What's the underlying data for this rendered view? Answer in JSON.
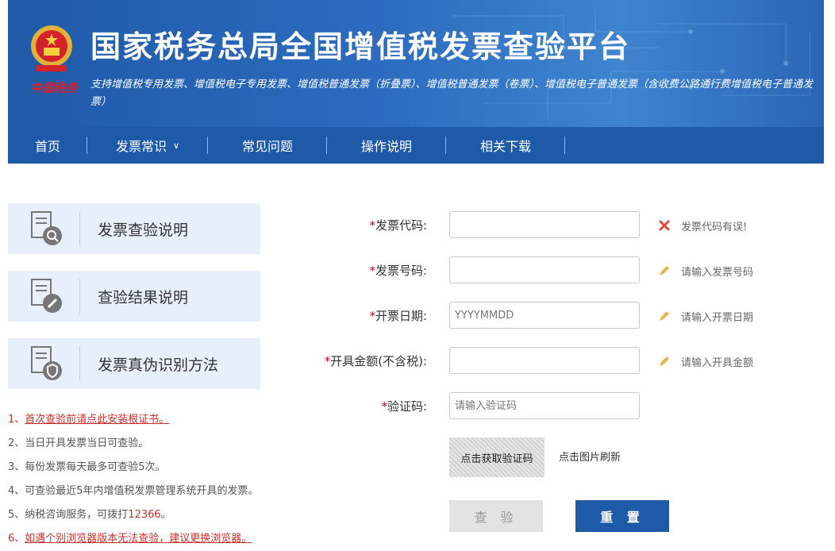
{
  "header": {
    "title": "国家税务总局全国增值税发票查验平台",
    "emblem_text": "中国税务",
    "subtitle": "支持增值税专用发票、增值税电子专用发票、增值税普通发票（折叠票）、增值税普通发票（卷票）、增值税电子普通发票（含收费公路通行费增值税电子普通发票）"
  },
  "nav": [
    {
      "label": "首页"
    },
    {
      "label": "发票常识",
      "icon": "chevron-down-icon"
    },
    {
      "label": "常见问题"
    },
    {
      "label": "操作说明"
    },
    {
      "label": "相关下载"
    }
  ],
  "sidebar": [
    {
      "label": "发票查验说明",
      "icon": "document-search-icon"
    },
    {
      "label": "查验结果说明",
      "icon": "document-edit-icon"
    },
    {
      "label": "发票真伪识别方法",
      "icon": "document-shield-icon"
    }
  ],
  "notes": [
    {
      "prefix": "1、",
      "text": "首次查验前请点此安装根证书。"
    },
    {
      "prefix": "2、",
      "text": "当日开具发票当日可查验。"
    },
    {
      "prefix": "3、",
      "text": "每份发票每天最多可查验5次。"
    },
    {
      "prefix": "4、",
      "text": "可查验最近5年内增值税发票管理系统开具的发票。"
    },
    {
      "prefix": "5、",
      "text": "纳税咨询服务，可拨打",
      "highlight": "12366",
      "suffix": "。"
    },
    {
      "prefix": "6、",
      "text": "如遇个别浏览器版本无法查验，建议更换浏览器。"
    }
  ],
  "form": {
    "invoice_code": {
      "label": "发票代码:",
      "value": "",
      "status": "error",
      "hint": "发票代码有误!"
    },
    "invoice_number": {
      "label": "发票号码:",
      "value": "",
      "hint": "请输入发票号码"
    },
    "issue_date": {
      "label": "开票日期:",
      "placeholder": "YYYYMMDD",
      "hint": "请输入开票日期"
    },
    "amount": {
      "label": "开具金额(不含税):",
      "value": "",
      "hint": "请输入开具金额"
    },
    "captcha": {
      "label": "验证码:",
      "placeholder": "请输入验证码"
    },
    "required_mark": "*"
  },
  "captcha_image": {
    "text": "点击获取验证码",
    "refresh": "点击图片刷新"
  },
  "buttons": {
    "check": "查 验",
    "reset": "重 置"
  },
  "colors": {
    "brand_blue": "#1f5aa8",
    "error_red": "#e0493a",
    "required_red": "#d0021b"
  }
}
